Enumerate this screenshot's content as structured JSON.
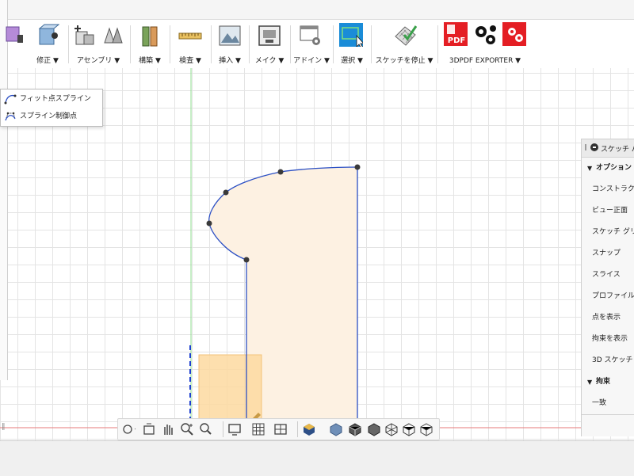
{
  "toolbar": {
    "groups": [
      {
        "label": "修正 ▼"
      },
      {
        "label": "アセンブリ ▼"
      },
      {
        "label": "構築 ▼"
      },
      {
        "label": "検査 ▼"
      },
      {
        "label": "挿入 ▼"
      },
      {
        "label": "メイク ▼"
      },
      {
        "label": "アドイン ▼"
      },
      {
        "label": "選択 ▼"
      },
      {
        "label": "スケッチを停止 ▼"
      },
      {
        "label": "3DPDF EXPORTER ▼"
      }
    ]
  },
  "spline_menu": {
    "items": [
      {
        "label": "フィット点スプライン"
      },
      {
        "label": "スプライン制御点"
      }
    ]
  },
  "palette": {
    "title": "スケッチ パレ",
    "options_title": "オプション",
    "options": [
      {
        "label": "コンストラクション"
      },
      {
        "label": "ビュー正面"
      },
      {
        "label": "スケッチ グリッド"
      },
      {
        "label": "スナップ"
      },
      {
        "label": "スライス"
      },
      {
        "label": "プロファイルを表示"
      },
      {
        "label": "点を表示"
      },
      {
        "label": "拘束を表示"
      },
      {
        "label": "3D スケッチ"
      }
    ],
    "constraints_title": "拘束",
    "constraints": [
      {
        "label": "一致"
      }
    ]
  },
  "colors": {
    "accent": "#1a8cd8",
    "spline": "#2b4fc4",
    "profile_fill": "#fdf1e2",
    "selection_fill": "#fdd9a0",
    "axis_green": "#7fd37f",
    "axis_red": "#e06060"
  }
}
